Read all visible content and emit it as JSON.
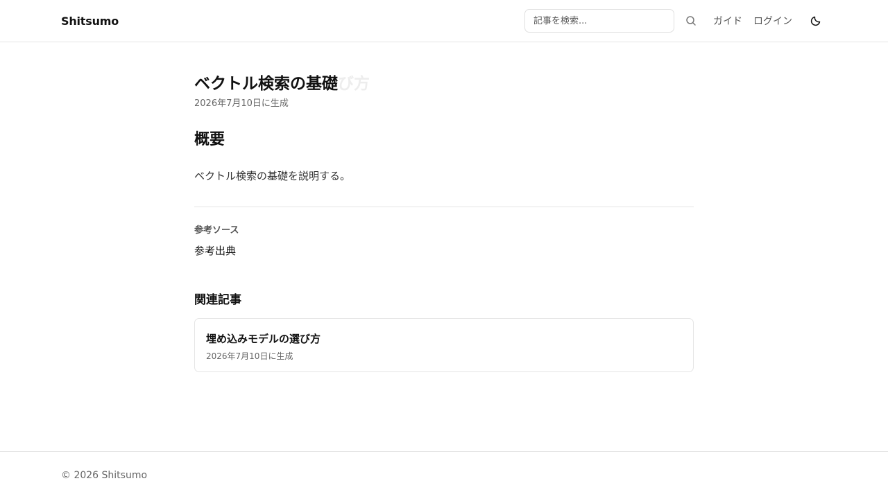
{
  "header": {
    "brand": "Shitsumo",
    "search": {
      "placeholder": "記事を検索...",
      "value": "",
      "icon": "search-icon"
    },
    "nav": [
      {
        "label": "ガイド"
      },
      {
        "label": "ログイン"
      }
    ],
    "theme_icon": "moon-icon"
  },
  "article": {
    "title": "ベクトル検索の基礎",
    "title_ghost": "ベクトル検索の基礎び方",
    "meta": "2026年7月10日に生成",
    "section_heading": "概要",
    "summary": "ベクトル検索の基礎を説明する。",
    "sources_label": "参考ソース",
    "sources": [
      {
        "label": "参考出典"
      }
    ],
    "related_heading": "関連記事",
    "related": [
      {
        "title": "埋め込みモデルの選び方",
        "meta": "2026年7月10日に生成"
      }
    ]
  },
  "footer": {
    "copyright": "© 2026 Shitsumo"
  }
}
